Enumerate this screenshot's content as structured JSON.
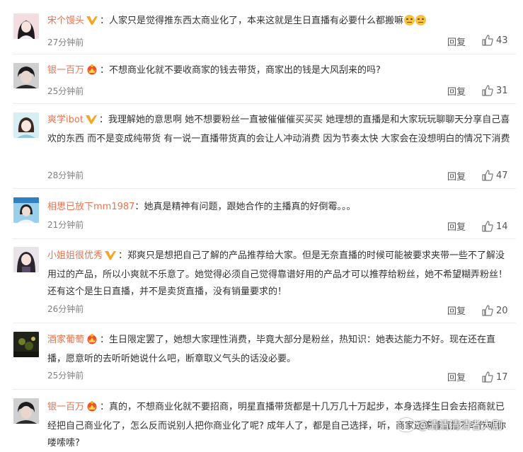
{
  "actions": {
    "reply_label": "回复"
  },
  "colors": {
    "username": "#eb7350",
    "text": "#333333",
    "meta": "#808080"
  },
  "icons": {
    "like": "thumbs-up-icon",
    "vip": "vip-crown-badge",
    "verified": "v-verified-badge"
  },
  "comments": [
    {
      "username": "宋个馒头",
      "badge": "verified-v",
      "text": "人家只是觉得推东西太商业化了，本来这就是生日直播有必要什么都搬嘛",
      "emoji": [
        "sweat-smile-emoji",
        "sweat-smile-emoji"
      ],
      "time": "27分钟前",
      "likes": "43"
    },
    {
      "username": "银一百万",
      "badge": "vip-crown",
      "text": "不想商业化就不要收商家的钱去带货，商家出的钱是大风刮来的吗?",
      "time": "25分钟前",
      "likes": "31"
    },
    {
      "username": "爽学ibot",
      "badge": "verified-v",
      "text": "我理解她的意思啊 她不想要粉丝一直被催催催买买买 她理想的直播是和大家玩玩聊聊天分享自己喜欢的东西 而不是变成纯带货 有一说一直播带货真的会让人冲动消费 因为节奏太快 大家会在没想明白的情况下消费",
      "time": "28分钟前",
      "likes": "47"
    },
    {
      "username": "相思已放下mm1987",
      "badge": "",
      "text": "她真是精神有问题，跟她合作的主播真的好倒霉。。。",
      "time": "21分钟前",
      "likes": "14"
    },
    {
      "username": "小姐姐很优秀",
      "badge": "verified-v",
      "text": "郑爽只是想把自己了解的产品推荐给大家。但是无奈直播的时候可能被要求夹带一些不了解没用过的产品，所以小爽就不乐意了。她觉得必须自己觉得靠谱好用的产品才可以推荐给粉丝，她不希望糊弄粉丝！还有这个是生日直播，并不是卖货直播，没有销量要求的！",
      "time": "26分钟前",
      "likes": "20"
    },
    {
      "username": "酒家葡萄",
      "badge": "vip-crown",
      "text": "生日限定罢了，她想大家理性消费，毕竟大部分是粉丝，热知识：她表达能力不好。现在还在直播，愿意听的去听听她说什么吧，断章取义气头的话没必要。",
      "time": "25分钟前",
      "likes": "17"
    },
    {
      "username": "银一百万",
      "badge": "vip-crown",
      "text": "真的，不想商业化就不要招商，明星直播带货都是十几万几十万起步，本身选择生日会去招商就已经把自己商业化了，怎么反而说别人把你商业化了呢? 成年人了，都是自己选择，听，商家还等着直播不幸作听你喽嗦嗦?",
      "time": "",
      "likes": ""
    }
  ],
  "watermark": {
    "text": "@清清清清者大剧"
  }
}
